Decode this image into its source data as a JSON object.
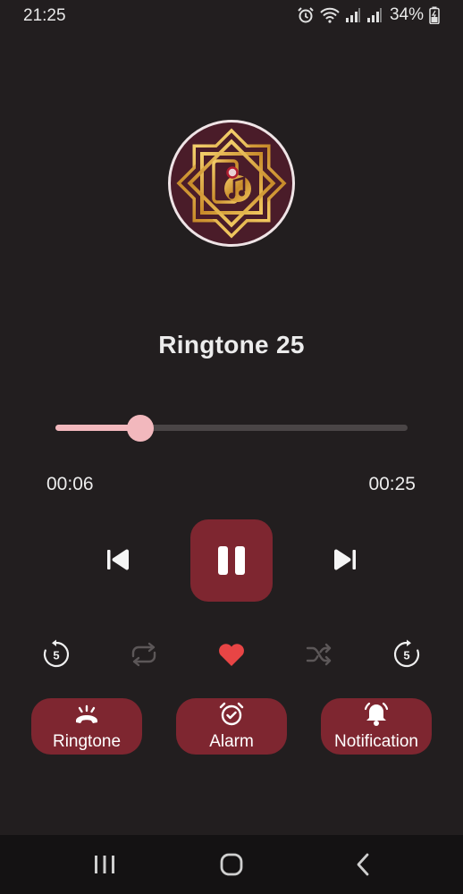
{
  "status_bar": {
    "time": "21:25",
    "battery": "34%",
    "icons": [
      "alarm-icon",
      "wifi-icon",
      "signal-icon",
      "signal-icon",
      "battery-charging-icon"
    ]
  },
  "player": {
    "title": "Ringtone 25",
    "elapsed": "00:06",
    "total": "00:25",
    "progress_fraction": 0.24,
    "is_playing": true
  },
  "controls": {
    "icons": [
      "skip-previous-icon",
      "pause-icon",
      "skip-next-icon"
    ],
    "secondary_icons": [
      "replay-5-icon",
      "repeat-icon",
      "favorite-heart-icon",
      "shuffle-icon",
      "forward-5-icon"
    ],
    "replay_value": "5",
    "forward_value": "5"
  },
  "actions": {
    "ringtone_label": "Ringtone",
    "alarm_label": "Alarm",
    "notification_label": "Notification"
  },
  "colors": {
    "background": "#221e1f",
    "accent": "#7e2630",
    "progress": "#f2b8bd",
    "heart": "#e84545",
    "artwork_gold": "#d4a23a"
  }
}
